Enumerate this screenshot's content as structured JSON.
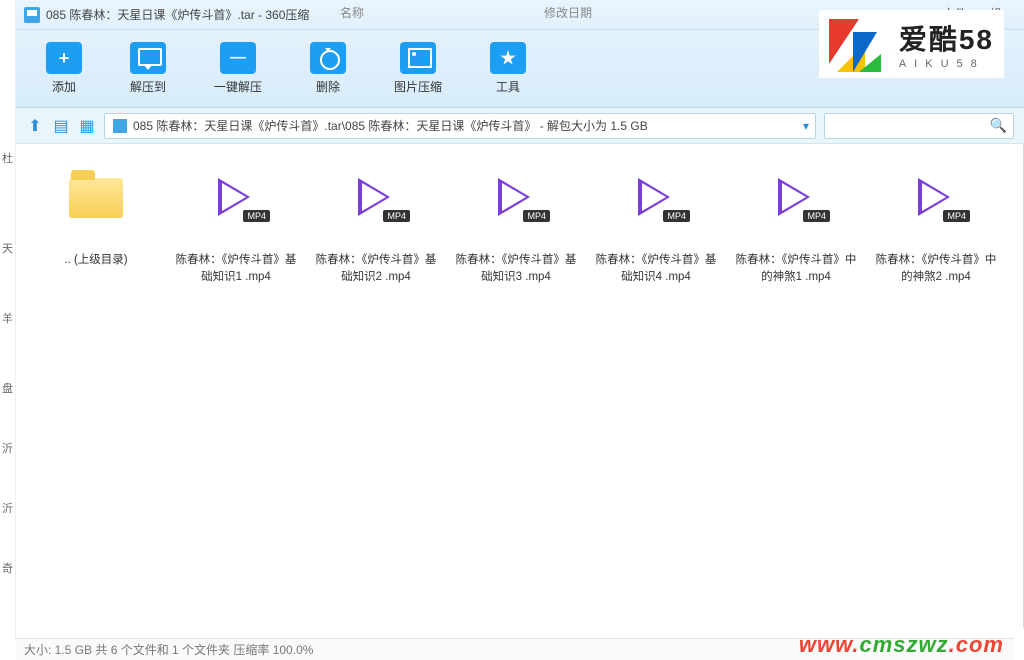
{
  "bg": {
    "col1": "名称",
    "col2": "修改日期"
  },
  "titlebar": {
    "text": "085 陈春林：天星日课《炉传斗首》.tar - 360压缩"
  },
  "menu": {
    "file": "文件",
    "op": "操"
  },
  "toolbar": {
    "add": "添加",
    "extract": "解压到",
    "oneclick": "一键解压",
    "delete": "删除",
    "imgcomp": "图片压缩",
    "tools": "工具"
  },
  "logo": {
    "cn": "爱酷58",
    "en": "AIKU58"
  },
  "path": {
    "text": "085 陈春林：天星日课《炉传斗首》.tar\\085 陈春林：天星日课《炉传斗首》 - 解包大小为 1.5 GB"
  },
  "search": {
    "placeholder": ""
  },
  "files": {
    "up": ".. (上级目录)",
    "badge": "MP4",
    "f1": "陈春林：《炉传斗首》基础知识1 .mp4",
    "f2": "陈春林：《炉传斗首》基础知识2 .mp4",
    "f3": "陈春林：《炉传斗首》基础知识3 .mp4",
    "f4": "陈春林：《炉传斗首》基础知识4 .mp4",
    "f5": "陈春林：《炉传斗首》中的神煞1 .mp4",
    "f6": "陈春林：《炉传斗首》中的神煞2 .mp4"
  },
  "status": {
    "text": "大小: 1.5 GB 共 6 个文件和 1 个文件夹 压缩率 100.0%"
  },
  "leftbits": {
    "a": "杜",
    "b": "天",
    "c": "羊",
    "d": "盘",
    "e": "沂",
    "f": "沂",
    "g": "奇"
  },
  "url": {
    "w": "www.",
    "d": "cmszwz",
    "c": ".com"
  }
}
